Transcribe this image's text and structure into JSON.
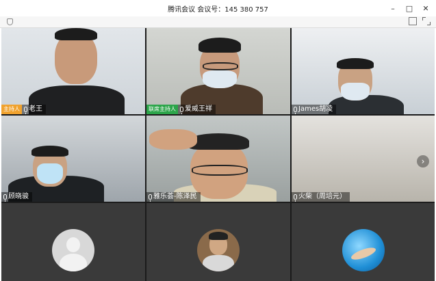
{
  "window": {
    "title": "腾讯会议 会议号：145 380 757",
    "controls": {
      "minimize": "–",
      "maximize": "□",
      "close": "✕"
    }
  },
  "toolbar": {
    "left_icon": "shield-icon",
    "right_icons": [
      "layout-icon",
      "fullscreen-icon"
    ]
  },
  "tiles": [
    {
      "name": "老王",
      "role": "主持人",
      "role_color": "#f0a22e",
      "mic": "mic-icon",
      "bg": "#d9dde1"
    },
    {
      "name": "爱威王祥",
      "role": "联席主持人",
      "role_color": "#2ca54a",
      "mic": "mic-icon",
      "bg": "#c9ccc8"
    },
    {
      "name": "James胡凌",
      "role": "",
      "mic": "mic-icon",
      "bg": "#cfd6dc"
    },
    {
      "name": "顾晓骏",
      "role": "",
      "mic": "mic-icon",
      "bg": "#b9bfc4"
    },
    {
      "name": "雅乐荟-陈泽民",
      "role": "",
      "mic": "mic-icon",
      "bg": "#aeb3b2"
    },
    {
      "name": "火柴（周培元）",
      "role": "",
      "mic": "mic-icon",
      "bg": "#d5d2cc",
      "nav": "›"
    },
    {
      "avatar": "default-avatar"
    },
    {
      "avatar": "photo-avatar"
    },
    {
      "avatar": "photo-avatar-water"
    }
  ]
}
